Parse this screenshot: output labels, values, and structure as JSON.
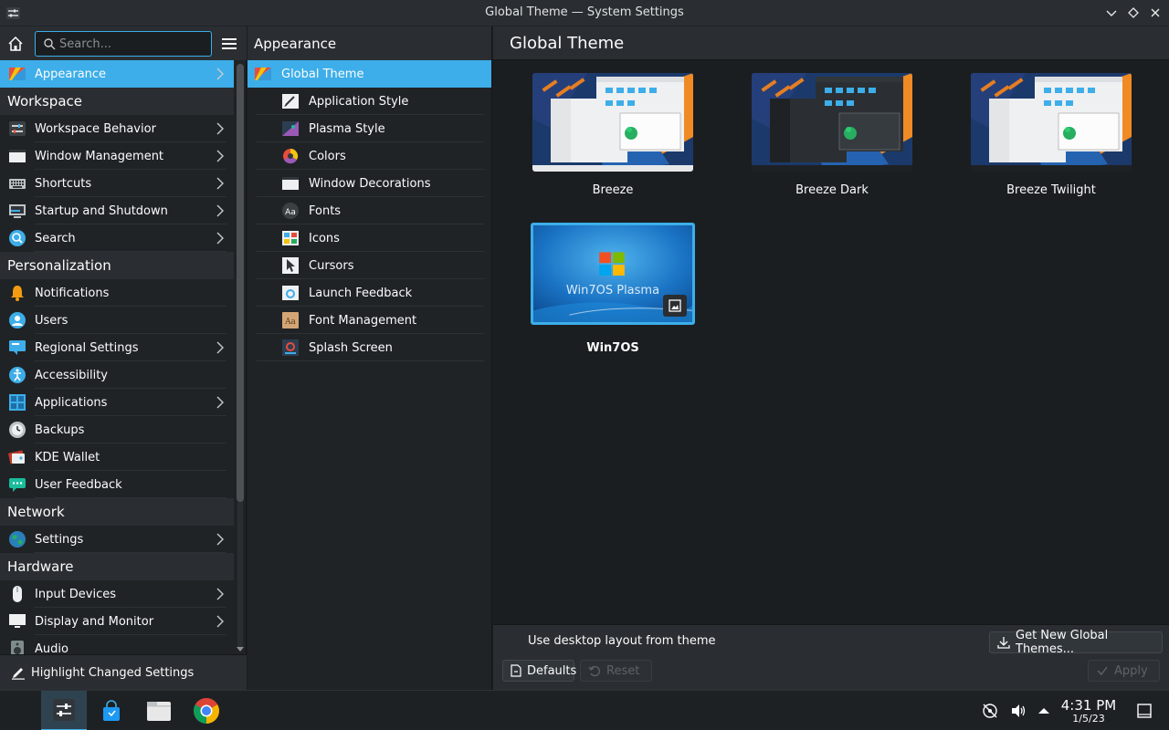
{
  "window": {
    "title": "Global Theme — System Settings"
  },
  "search": {
    "placeholder": "Search..."
  },
  "sidebar": {
    "selected_label": "Appearance",
    "groups": [
      {
        "type": "item",
        "label": "Appearance",
        "icon": "appearance-icon",
        "chevron": true,
        "selected": true
      },
      {
        "type": "header",
        "label": "Workspace"
      },
      {
        "type": "item",
        "label": "Workspace Behavior",
        "icon": "workspace-behavior-icon",
        "chevron": true
      },
      {
        "type": "item",
        "label": "Window Management",
        "icon": "window-management-icon",
        "chevron": true
      },
      {
        "type": "item",
        "label": "Shortcuts",
        "icon": "keyboard-icon",
        "chevron": true
      },
      {
        "type": "item",
        "label": "Startup and Shutdown",
        "icon": "startup-icon",
        "chevron": true
      },
      {
        "type": "item",
        "label": "Search",
        "icon": "search-icon",
        "chevron": true
      },
      {
        "type": "header",
        "label": "Personalization"
      },
      {
        "type": "item",
        "label": "Notifications",
        "icon": "bell-icon",
        "chevron": false
      },
      {
        "type": "item",
        "label": "Users",
        "icon": "users-icon",
        "chevron": false
      },
      {
        "type": "item",
        "label": "Regional Settings",
        "icon": "regional-icon",
        "chevron": true
      },
      {
        "type": "item",
        "label": "Accessibility",
        "icon": "accessibility-icon",
        "chevron": false
      },
      {
        "type": "item",
        "label": "Applications",
        "icon": "applications-icon",
        "chevron": true
      },
      {
        "type": "item",
        "label": "Backups",
        "icon": "backups-icon",
        "chevron": false
      },
      {
        "type": "item",
        "label": "KDE Wallet",
        "icon": "wallet-icon",
        "chevron": false
      },
      {
        "type": "item",
        "label": "User Feedback",
        "icon": "feedback-icon",
        "chevron": false
      },
      {
        "type": "header",
        "label": "Network"
      },
      {
        "type": "item",
        "label": "Settings",
        "icon": "globe-icon",
        "chevron": true
      },
      {
        "type": "header",
        "label": "Hardware"
      },
      {
        "type": "item",
        "label": "Input Devices",
        "icon": "mouse-icon",
        "chevron": true
      },
      {
        "type": "item",
        "label": "Display and Monitor",
        "icon": "monitor-icon",
        "chevron": true
      },
      {
        "type": "item",
        "label": "Audio",
        "icon": "audio-icon",
        "chevron": false
      }
    ],
    "highlight_label": "Highlight Changed Settings"
  },
  "middle": {
    "title": "Appearance",
    "items": [
      {
        "label": "Global Theme",
        "icon": "global-theme-icon",
        "selected": true
      },
      {
        "label": "Application Style",
        "icon": "application-style-icon"
      },
      {
        "label": "Plasma Style",
        "icon": "plasma-style-icon"
      },
      {
        "label": "Colors",
        "icon": "colors-icon"
      },
      {
        "label": "Window Decorations",
        "icon": "window-decorations-icon"
      },
      {
        "label": "Fonts",
        "icon": "fonts-icon"
      },
      {
        "label": "Icons",
        "icon": "icons-icon"
      },
      {
        "label": "Cursors",
        "icon": "cursors-icon"
      },
      {
        "label": "Launch Feedback",
        "icon": "launch-feedback-icon"
      },
      {
        "label": "Font Management",
        "icon": "font-management-icon"
      },
      {
        "label": "Splash Screen",
        "icon": "splash-screen-icon"
      }
    ]
  },
  "content": {
    "title": "Global Theme",
    "themes": [
      {
        "name": "Breeze",
        "style": "light"
      },
      {
        "name": "Breeze Dark",
        "style": "dark"
      },
      {
        "name": "Breeze Twilight",
        "style": "twilight"
      },
      {
        "name": "Win7OS",
        "style": "win7",
        "selected": true,
        "preview_text": "Win7OS Plasma"
      }
    ],
    "use_desktop_layout_label": "Use desktop layout from theme",
    "get_new_label": "Get New Global Themes...",
    "defaults_label": "Defaults",
    "reset_label": "Reset",
    "apply_label": "Apply"
  },
  "taskbar": {
    "time": "4:31 PM",
    "date": "1/5/23"
  },
  "colors": {
    "accent": "#3daee9",
    "bg": "#1b1e20",
    "panel": "#202326",
    "header": "#2a2e32"
  }
}
